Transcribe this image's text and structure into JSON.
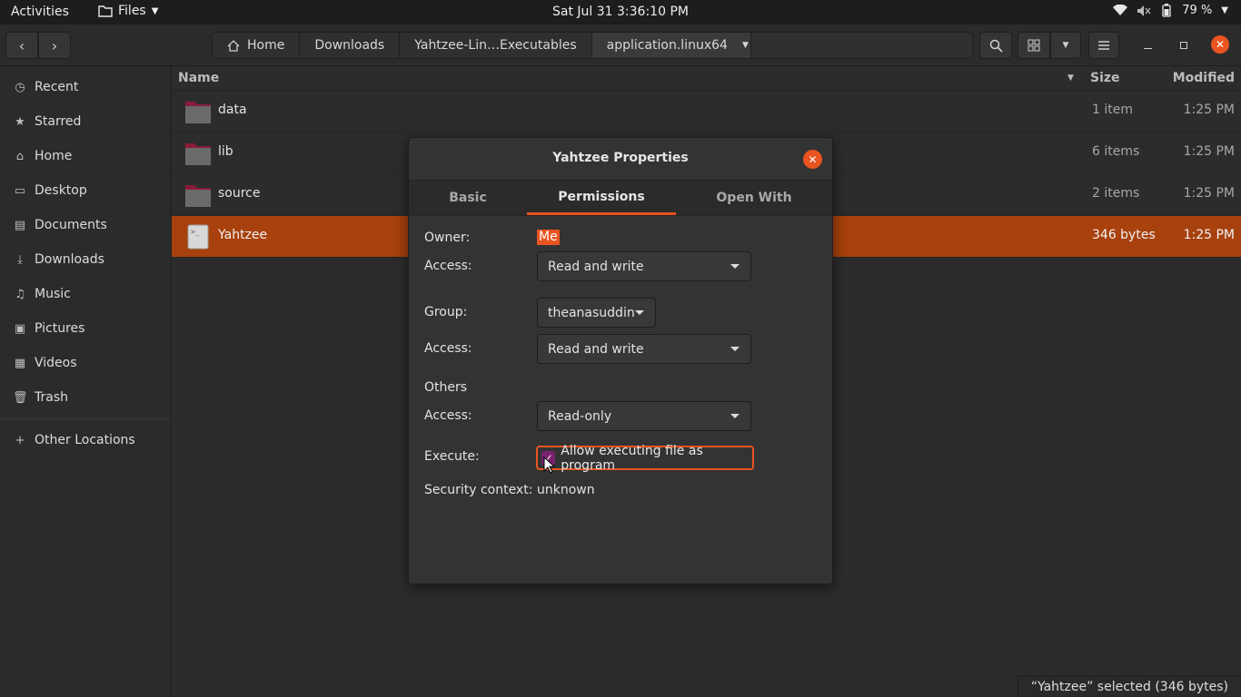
{
  "topbar": {
    "activities": "Activities",
    "app_menu": "Files",
    "clock": "Sat Jul 31   3:36:10 PM",
    "battery": "79 %"
  },
  "headerbar": {
    "crumbs": [
      "Home",
      "Downloads",
      "Yahtzee-Lin…Executables",
      "application.linux64"
    ]
  },
  "sidebar": {
    "items": [
      "Recent",
      "Starred",
      "Home",
      "Desktop",
      "Documents",
      "Downloads",
      "Music",
      "Pictures",
      "Videos",
      "Trash"
    ],
    "other": "Other Locations"
  },
  "list": {
    "columns": {
      "name": "Name",
      "size": "Size",
      "modified": "Modified"
    },
    "rows": [
      {
        "name": "data",
        "size": "1 item",
        "modified": "1:25 PM"
      },
      {
        "name": "lib",
        "size": "6 items",
        "modified": "1:25 PM"
      },
      {
        "name": "source",
        "size": "2 items",
        "modified": "1:25 PM"
      },
      {
        "name": "Yahtzee",
        "size": "346 bytes",
        "modified": "1:25 PM"
      }
    ],
    "status": "“Yahtzee” selected  (346 bytes)"
  },
  "dialog": {
    "title": "Yahtzee Properties",
    "tabs": [
      "Basic",
      "Permissions",
      "Open With"
    ],
    "owner_label": "Owner:",
    "owner_value": "Me",
    "access_label": "Access:",
    "owner_access": "Read and write",
    "group_label": "Group:",
    "group_value": "theanasuddin",
    "group_access": "Read and write",
    "others_label": "Others",
    "others_access": "Read-only",
    "execute_label": "Execute:",
    "execute_text": "Allow executing file as program",
    "security_label": "Security context:",
    "security_value": "unknown"
  },
  "colors": {
    "accent": "#e95420",
    "selection": "#a8410d",
    "check": "#77216f"
  }
}
